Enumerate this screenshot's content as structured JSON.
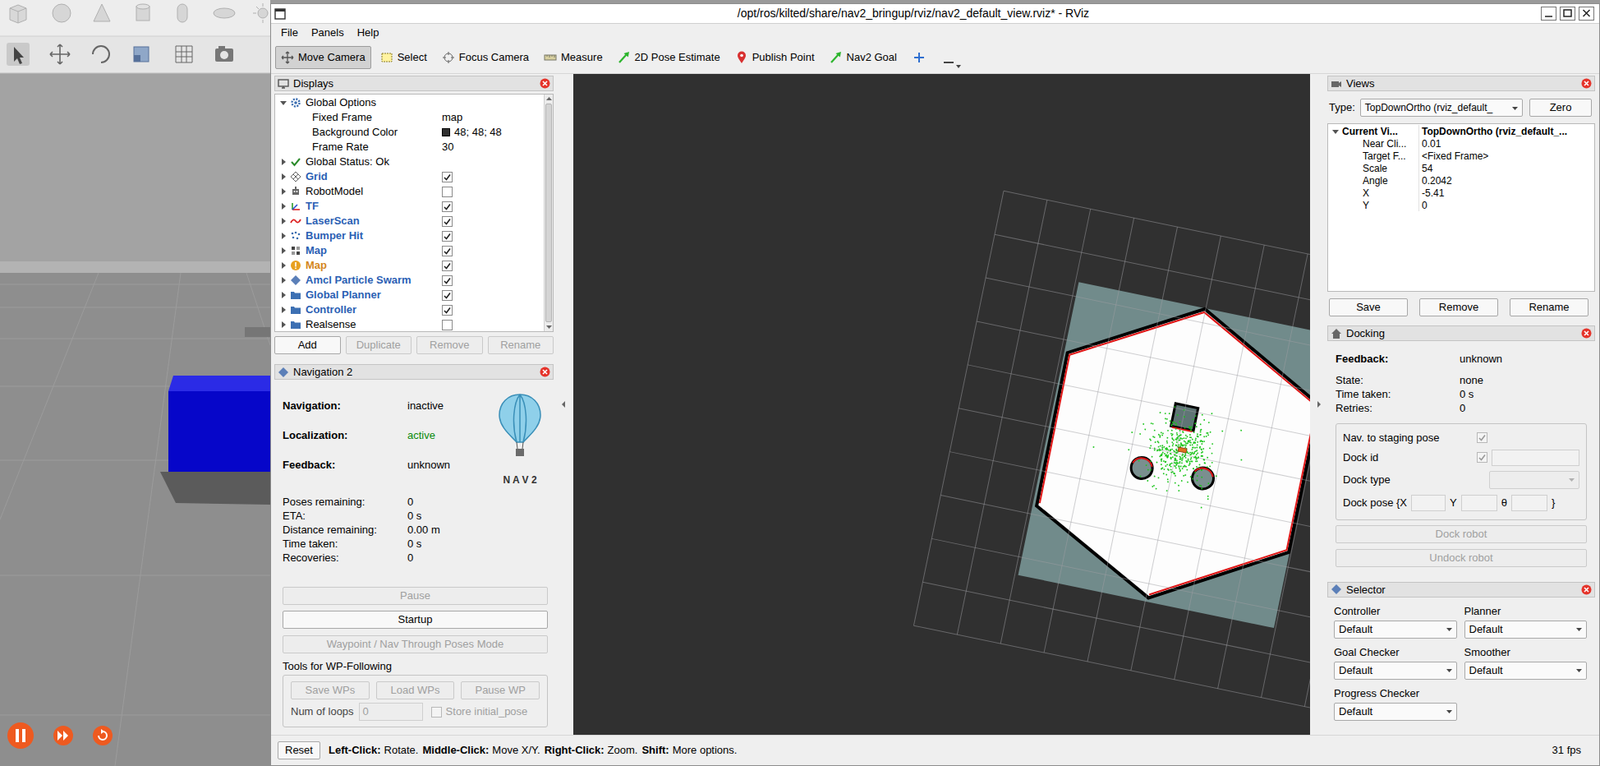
{
  "window": {
    "title": "/opt/ros/kilted/share/nav2_bringup/rviz/nav2_default_view.rviz* - RViz"
  },
  "menu": [
    "File",
    "Panels",
    "Help"
  ],
  "toolbar": [
    {
      "label": "Move Camera",
      "selected": true
    },
    {
      "label": "Select",
      "selected": false
    },
    {
      "label": "Focus Camera",
      "selected": false
    },
    {
      "label": "Measure",
      "selected": false
    },
    {
      "label": "2D Pose Estimate",
      "selected": false
    },
    {
      "label": "Publish Point",
      "selected": false
    },
    {
      "label": "Nav2 Goal",
      "selected": false
    }
  ],
  "displays": {
    "title": "Displays",
    "rows": [
      {
        "kind": "group",
        "label": "Global Options",
        "expanded": true,
        "color": "#000000"
      },
      {
        "kind": "property",
        "label": "Fixed Frame",
        "value": "map"
      },
      {
        "kind": "property",
        "label": "Background Color",
        "value": "48; 48; 48",
        "color": "#303030"
      },
      {
        "kind": "property",
        "label": "Frame Rate",
        "value": "30"
      },
      {
        "kind": "status",
        "label": "Global Status: Ok",
        "expanded": false,
        "color": "#000000"
      },
      {
        "kind": "display",
        "label": "Grid",
        "expanded": false,
        "checked": true,
        "color": "#2b5fb4"
      },
      {
        "kind": "display",
        "label": "RobotModel",
        "expanded": false,
        "checked": false,
        "color": "#000000"
      },
      {
        "kind": "display",
        "label": "TF",
        "expanded": false,
        "checked": true,
        "color": "#2b5fb4"
      },
      {
        "kind": "display",
        "label": "LaserScan",
        "expanded": false,
        "checked": true,
        "color": "#2b5fb4"
      },
      {
        "kind": "display",
        "label": "Bumper Hit",
        "expanded": false,
        "checked": true,
        "color": "#2b5fb4"
      },
      {
        "kind": "display",
        "label": "Map",
        "expanded": false,
        "checked": true,
        "color": "#2b5fb4"
      },
      {
        "kind": "display",
        "label": "Map",
        "expanded": false,
        "checked": true,
        "color": "#d4871c"
      },
      {
        "kind": "display",
        "label": "Amcl Particle Swarm",
        "expanded": false,
        "checked": true,
        "color": "#2b5fb4"
      },
      {
        "kind": "display",
        "label": "Global Planner",
        "expanded": false,
        "checked": true,
        "color": "#2b5fb4"
      },
      {
        "kind": "display",
        "label": "Controller",
        "expanded": false,
        "checked": true,
        "color": "#2b5fb4"
      },
      {
        "kind": "display",
        "label": "Realsense",
        "expanded": false,
        "checked": false,
        "color": "#000000"
      }
    ],
    "buttons": [
      {
        "label": "Add",
        "disabled": false
      },
      {
        "label": "Duplicate",
        "disabled": true
      },
      {
        "label": "Remove",
        "disabled": true
      },
      {
        "label": "Rename",
        "disabled": true
      }
    ]
  },
  "navigation": {
    "title": "Navigation 2",
    "status": [
      {
        "label": "Navigation:",
        "value": "inactive",
        "color": "#000000"
      },
      {
        "label": "Localization:",
        "value": "active",
        "color": "#0a8a0a"
      },
      {
        "label": "Feedback:",
        "value": "unknown",
        "color": "#000000"
      }
    ],
    "logo": "N A V 2",
    "stats": [
      {
        "label": "Poses remaining:",
        "value": "0"
      },
      {
        "label": "ETA:",
        "value": "0 s"
      },
      {
        "label": "Distance remaining:",
        "value": "0.00 m"
      },
      {
        "label": "Time taken:",
        "value": "0 s"
      },
      {
        "label": "Recoveries:",
        "value": "0"
      }
    ],
    "buttons": [
      {
        "label": "Pause",
        "disabled": true
      },
      {
        "label": "Startup",
        "disabled": false
      },
      {
        "label": "Waypoint / Nav Through Poses Mode",
        "disabled": true
      }
    ],
    "wp": {
      "title": "Tools for WP-Following",
      "buttons": [
        {
          "label": "Save WPs",
          "disabled": true
        },
        {
          "label": "Load WPs",
          "disabled": true
        },
        {
          "label": "Pause WP",
          "disabled": true
        }
      ],
      "loops_label": "Num of loops",
      "loops_value": "0",
      "loops_disabled": true,
      "store_label": "Store initial_pose",
      "store_checked": false,
      "store_disabled": true
    }
  },
  "views": {
    "title": "Views",
    "type_label": "Type:",
    "type_value": "TopDownOrtho (rviz_default_",
    "zero": "Zero",
    "current": {
      "label": "Current Vi...",
      "value": "TopDownOrtho (rviz_default_...",
      "expanded": true
    },
    "props": [
      {
        "label": "Near Cli...",
        "value": "0.01"
      },
      {
        "label": "Target F...",
        "value": "<Fixed Frame>"
      },
      {
        "label": "Scale",
        "value": "54"
      },
      {
        "label": "Angle",
        "value": "0.2042"
      },
      {
        "label": "X",
        "value": "-5.41"
      },
      {
        "label": "Y",
        "value": "0"
      }
    ],
    "buttons": [
      "Save",
      "Remove",
      "Rename"
    ]
  },
  "docking": {
    "title": "Docking",
    "feedback_label": "Feedback:",
    "feedback_value": "unknown",
    "rows": [
      {
        "label": "State:",
        "value": "none"
      },
      {
        "label": "Time taken:",
        "value": "0 s"
      },
      {
        "label": "Retries:",
        "value": "0"
      }
    ],
    "staging": {
      "label": "Nav. to staging pose",
      "checked": true,
      "disabled": true
    },
    "dock_id": {
      "label": "Dock id",
      "checked": true,
      "value": ""
    },
    "dock_type": {
      "label": "Dock type",
      "value": "",
      "disabled": true
    },
    "dock_pose": {
      "label": "Dock pose {X",
      "y": "Y",
      "theta": "θ",
      "end": "}"
    },
    "buttons": [
      {
        "label": "Dock robot",
        "disabled": true
      },
      {
        "label": "Undock robot",
        "disabled": true
      }
    ]
  },
  "selector": {
    "title": "Selector",
    "fields": [
      {
        "label": "Controller",
        "value": "Default"
      },
      {
        "label": "Planner",
        "value": "Default"
      },
      {
        "label": "Goal Checker",
        "value": "Default"
      },
      {
        "label": "Smoother",
        "value": "Default"
      },
      {
        "label": "Progress Checker",
        "value": "Default"
      }
    ]
  },
  "status_bar": {
    "reset": "Reset",
    "hints": [
      {
        "key": "Left-Click:",
        "text": "Rotate."
      },
      {
        "key": "Middle-Click:",
        "text": "Move X/Y."
      },
      {
        "key": "Right-Click:",
        "text": "Zoom."
      },
      {
        "key": "Shift:",
        "text": "More options."
      }
    ],
    "fps": "31 fps"
  }
}
